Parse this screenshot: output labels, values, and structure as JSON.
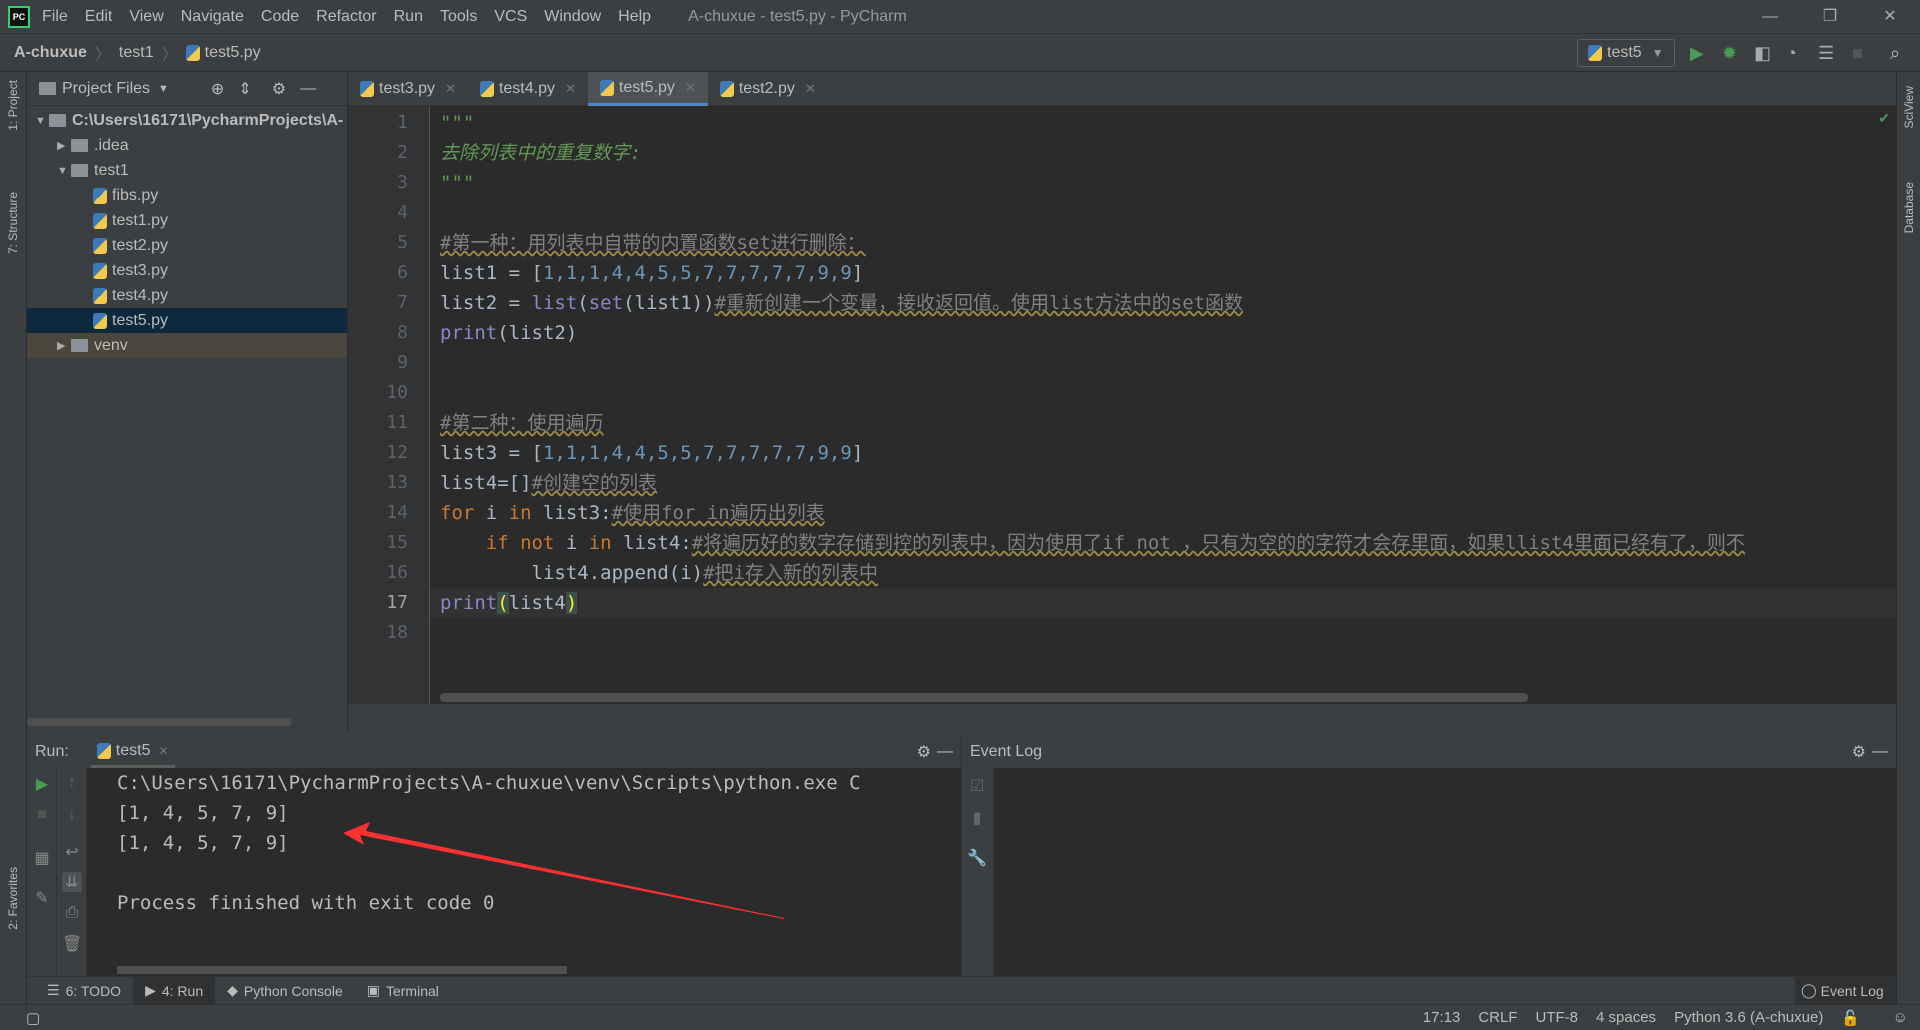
{
  "menubar": {
    "logo": "PC",
    "items": [
      "File",
      "Edit",
      "View",
      "Navigate",
      "Code",
      "Refactor",
      "Run",
      "Tools",
      "VCS",
      "Window",
      "Help"
    ],
    "title": "A-chuxue - test5.py - PyCharm"
  },
  "breadcrumb": [
    "A-chuxue",
    "test1",
    "test5.py"
  ],
  "toolbar": {
    "run_config": "test5"
  },
  "left_strip": {
    "project": "1: Project",
    "structure": "7: Structure",
    "favorites": "2: Favorites"
  },
  "right_strip": {
    "sciview": "SciView",
    "database": "Database"
  },
  "project": {
    "header": "Project Files",
    "tree": [
      {
        "label": "C:\\Users\\16171\\PycharmProjects\\A-",
        "type": "folder",
        "expanded": true,
        "depth": 0
      },
      {
        "label": ".idea",
        "type": "folder",
        "expanded": false,
        "depth": 1
      },
      {
        "label": "test1",
        "type": "folder",
        "expanded": true,
        "depth": 1
      },
      {
        "label": "fibs.py",
        "type": "file",
        "depth": 2
      },
      {
        "label": "test1.py",
        "type": "file",
        "depth": 2
      },
      {
        "label": "test2.py",
        "type": "file",
        "depth": 2
      },
      {
        "label": "test3.py",
        "type": "file",
        "depth": 2
      },
      {
        "label": "test4.py",
        "type": "file",
        "depth": 2
      },
      {
        "label": "test5.py",
        "type": "file",
        "depth": 2,
        "selected": true
      },
      {
        "label": "venv",
        "type": "folder",
        "expanded": false,
        "depth": 1
      }
    ]
  },
  "tabs": [
    {
      "label": "test3.py"
    },
    {
      "label": "test4.py"
    },
    {
      "label": "test5.py",
      "active": true
    },
    {
      "label": "test2.py"
    }
  ],
  "editor": {
    "current_line": 17,
    "lines": [
      [
        [
          "\"\"\"",
          "doc"
        ]
      ],
      [
        [
          "去除列表中的重复数字:",
          "doc"
        ]
      ],
      [
        [
          "\"\"\"",
          "doc"
        ]
      ],
      [],
      [
        [
          "#第一种：用列表中自带的内置函数set进行删除：",
          "cm"
        ]
      ],
      [
        [
          "list1 = [",
          "plain"
        ],
        [
          "1,1,1,4,4,5,5,7,7,7,7,7,9,9",
          "num"
        ],
        [
          "]",
          "plain"
        ]
      ],
      [
        [
          "list2 = ",
          "plain"
        ],
        [
          "list",
          "bi"
        ],
        [
          "(",
          "plain"
        ],
        [
          "set",
          "bi"
        ],
        [
          "(list1))",
          "plain"
        ],
        [
          "#重新创建一个变量，接收返回值。使用list方法中的set函数",
          "cm"
        ]
      ],
      [
        [
          "print",
          "bi"
        ],
        [
          "(list2)",
          "plain"
        ]
      ],
      [],
      [],
      [
        [
          "#第二种：使用遍历",
          "cm"
        ]
      ],
      [
        [
          "list3 = [",
          "plain"
        ],
        [
          "1,1,1,4,4,5,5,7,7,7,7,7,9,9",
          "num"
        ],
        [
          "]",
          "plain"
        ]
      ],
      [
        [
          "list4=[]",
          "plain"
        ],
        [
          "#创建空的列表",
          "cm"
        ]
      ],
      [
        [
          "for ",
          "kw"
        ],
        [
          "i ",
          "plain"
        ],
        [
          "in ",
          "kw"
        ],
        [
          "list3:",
          "plain"
        ],
        [
          "#使用for in遍历出列表",
          "cm"
        ]
      ],
      [
        [
          "    if not ",
          "kw"
        ],
        [
          "i ",
          "plain"
        ],
        [
          "in ",
          "kw"
        ],
        [
          "list4:",
          "plain"
        ],
        [
          "#将遍历好的数字存储到控的列表中，因为使用了if not ，只有为空的的字符才会存里面，如果llist4里面已经有了，则不",
          "cm"
        ]
      ],
      [
        [
          "        list4.append(i)",
          "plain"
        ],
        [
          "#把i存入新的列表中",
          "cm"
        ]
      ],
      [
        [
          "print",
          "bi"
        ],
        [
          "(",
          "pm"
        ],
        [
          "list4",
          "plain"
        ],
        [
          ")",
          "pm"
        ]
      ],
      []
    ]
  },
  "run": {
    "label": "Run:",
    "tab": "test5",
    "output": [
      "C:\\Users\\16171\\PycharmProjects\\A-chuxue\\venv\\Scripts\\python.exe C",
      "[1, 4, 5, 7, 9]",
      "[1, 4, 5, 7, 9]",
      "",
      "Process finished with exit code 0"
    ]
  },
  "event_log": {
    "title": "Event Log"
  },
  "bottom_tabs": [
    {
      "label": "6: TODO"
    },
    {
      "label": "4: Run",
      "active": true
    },
    {
      "label": "Python Console"
    },
    {
      "label": "Terminal"
    }
  ],
  "bottom_right": "Event Log",
  "status": {
    "position": "17:13",
    "line_sep": "CRLF",
    "encoding": "UTF-8",
    "indent": "4 spaces",
    "interpreter": "Python 3.6 (A-chuxue)"
  },
  "annotation": {
    "arrow_color": "#ff3030"
  }
}
